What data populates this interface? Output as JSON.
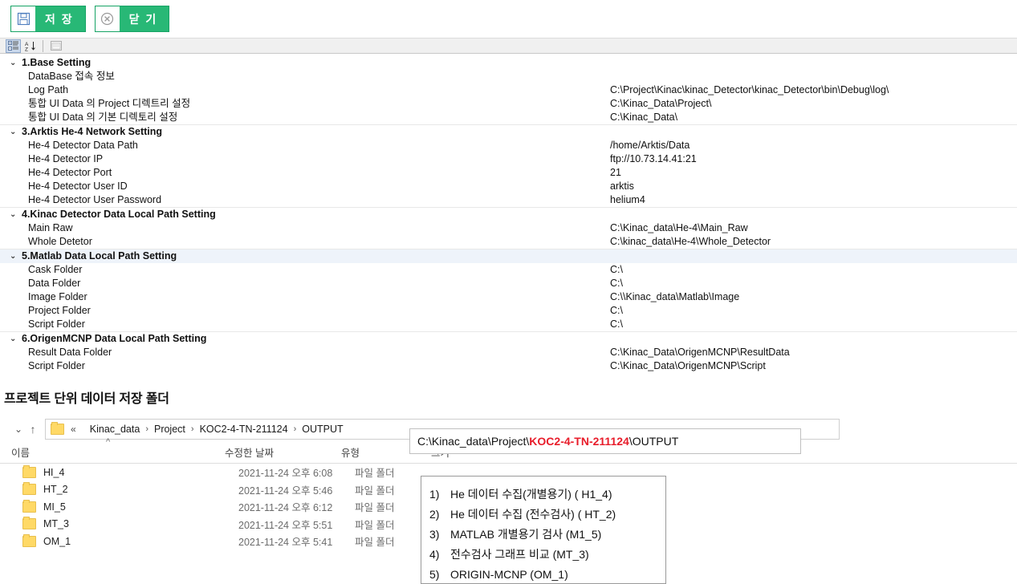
{
  "toolbar": {
    "save": {
      "label": "저 장",
      "icon": "floppy-disk-icon"
    },
    "close": {
      "label": "닫 기",
      "icon": "circle-x-icon"
    }
  },
  "propgrid_toolbar": {
    "categorized": "categorized-sort-icon",
    "alphabetical": "alphabetical-sort-icon",
    "property_pages": "property-pages-icon"
  },
  "propgrid": {
    "categories": [
      {
        "name": "1.Base Setting",
        "expanded": true,
        "properties": [
          {
            "name": "DataBase 접속 정보",
            "value": ""
          },
          {
            "name": "Log Path",
            "value": "C:\\Project\\Kinac\\kinac_Detector\\kinac_Detector\\bin\\Debug\\log\\"
          },
          {
            "name": "통합 UI Data 의 Project 디렉트리 설정",
            "value": "C:\\Kinac_Data\\Project\\"
          },
          {
            "name": "통합 UI Data 의 기본 디렉토리 설정",
            "value": "C:\\Kinac_Data\\"
          }
        ]
      },
      {
        "name": "3.Arktis He-4 Network Setting",
        "expanded": true,
        "properties": [
          {
            "name": "He-4 Detector Data Path",
            "value": "/home/Arktis/Data"
          },
          {
            "name": "He-4 Detector IP",
            "value": "ftp://10.73.14.41:21"
          },
          {
            "name": "He-4 Detector Port",
            "value": "21"
          },
          {
            "name": "He-4 Detector User ID",
            "value": "arktis"
          },
          {
            "name": "He-4 Detector User Password",
            "value": "helium4"
          }
        ]
      },
      {
        "name": "4.Kinac Detector Data Local Path Setting",
        "expanded": true,
        "properties": [
          {
            "name": "Main Raw",
            "value": "C:\\Kinac_data\\He-4\\Main_Raw"
          },
          {
            "name": "Whole Detetor",
            "value": "C:\\kinac_data\\He-4\\Whole_Detector"
          }
        ]
      },
      {
        "name": "5.Matlab Data Local Path Setting",
        "expanded": true,
        "selected": true,
        "properties": [
          {
            "name": "Cask Folder",
            "value": "C:\\"
          },
          {
            "name": "Data Folder",
            "value": "C:\\"
          },
          {
            "name": "Image Folder",
            "value": "C:\\\\Kinac_data\\Matlab\\Image"
          },
          {
            "name": "Project Folder",
            "value": "C:\\"
          },
          {
            "name": "Script Folder",
            "value": "C:\\"
          }
        ]
      },
      {
        "name": "6.OrigenMCNP Data Local Path Setting",
        "expanded": true,
        "properties": [
          {
            "name": "Result Data Folder",
            "value": "C:\\Kinac_Data\\OrigenMCNP\\ResultData"
          },
          {
            "name": "Script Folder",
            "value": "C:\\Kinac_Data\\OrigenMCNP\\Script"
          }
        ]
      }
    ]
  },
  "section": {
    "heading": "프로젝트 단위 데이터 저장 폴더"
  },
  "explorer": {
    "breadcrumb": {
      "prefix": "«",
      "parts": [
        "Kinac_data",
        "Project",
        "KOC2-4-TN-211124",
        "OUTPUT"
      ],
      "separator": "›"
    },
    "path_box": {
      "prefix": "C:\\Kinac_data\\Project\\",
      "highlight": "KOC2-4-TN-211124",
      "suffix": "\\OUTPUT",
      "highlight_color": "#e81c2a"
    },
    "columns": [
      "이름",
      "수정한 날짜",
      "유형",
      "크기"
    ],
    "sort_indicator": "^",
    "rows": [
      {
        "name": "HI_4",
        "date": "2021-11-24 오후 6:08",
        "type": "파일 폴더",
        "size": ""
      },
      {
        "name": "HT_2",
        "date": "2021-11-24 오후 5:46",
        "type": "파일 폴더",
        "size": ""
      },
      {
        "name": "MI_5",
        "date": "2021-11-24 오후 6:12",
        "type": "파일 폴더",
        "size": ""
      },
      {
        "name": "MT_3",
        "date": "2021-11-24 오후 5:51",
        "type": "파일 폴더",
        "size": ""
      },
      {
        "name": "OM_1",
        "date": "2021-11-24 오후 5:41",
        "type": "파일 폴더",
        "size": ""
      }
    ]
  },
  "legend": {
    "items": [
      {
        "num": "1)",
        "text": "He 데이터 수집(개별용기) ( H1_4)"
      },
      {
        "num": "2)",
        "text": "He 데이터 수집 (전수검사) ( HT_2)"
      },
      {
        "num": "3)",
        "text": "MATLAB 개별용기 검사 (M1_5)"
      },
      {
        "num": "4)",
        "text": "전수검사 그래프 비교 (MT_3)"
      },
      {
        "num": "5)",
        "text": "ORIGIN-MCNP (OM_1)"
      }
    ]
  },
  "colors": {
    "button_green": "#28b876",
    "highlight_red": "#e81c2a",
    "folder_yellow": "#ffd966"
  }
}
